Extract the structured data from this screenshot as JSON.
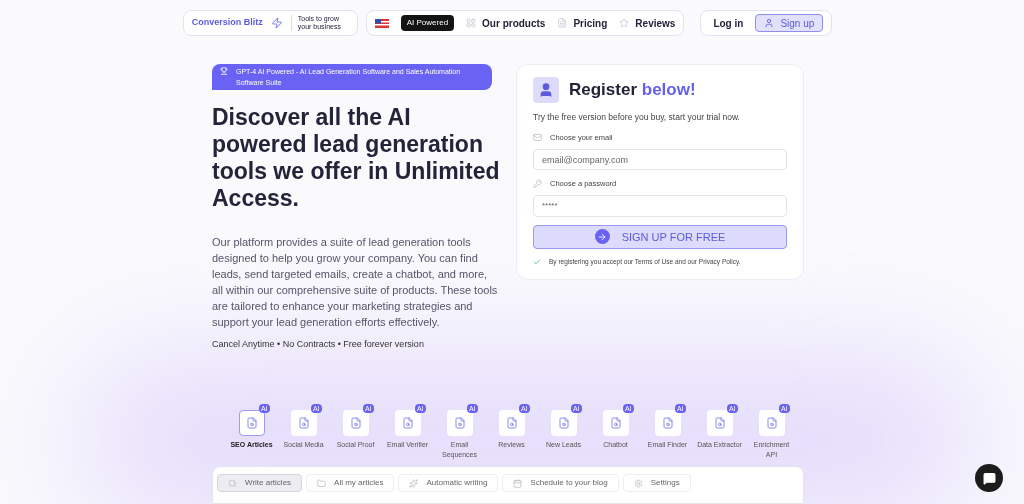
{
  "nav": {
    "brand": "Conversion Blitz",
    "tagline": "Tools to grow your business",
    "badge": "AI Powered",
    "links": [
      {
        "label": "Our products"
      },
      {
        "label": "Pricing"
      },
      {
        "label": "Reviews"
      }
    ],
    "login": "Log in",
    "signup": "Sign up"
  },
  "hero": {
    "pill": "GPT-4 AI Powered - AI Lead Generation Software and Sales Automation Software Suite",
    "title": "Discover all the AI powered lead generation tools we offer in Unlimited Access.",
    "body": "Our platform provides a suite of lead generation tools designed to help you grow your company. You can find leads, send targeted emails, create a chatbot, and more, all within our comprehensive suite of products. These tools are tailored to enhance your marketing strategies and support your lead generation efforts effectively.",
    "footnote": "Cancel Anytime • No Contracts • Free forever version"
  },
  "register": {
    "title": "Register",
    "title_accent": "below!",
    "subtitle": "Try the free version before you buy, start your trial now.",
    "email_label": "Choose your email",
    "email_placeholder": "email@company.com",
    "password_label": "Choose a password",
    "password_placeholder": "*****",
    "button": "SIGN UP FOR FREE",
    "terms": "By registering you accept our Terms of Use and our Privacy Policy."
  },
  "tools": [
    {
      "label": "SEO Articles",
      "badge": "AI",
      "selected": true
    },
    {
      "label": "Social Media",
      "badge": "AI",
      "selected": false
    },
    {
      "label": "Social Proof",
      "badge": "AI",
      "selected": false
    },
    {
      "label": "Email Verifier",
      "badge": "AI",
      "selected": false
    },
    {
      "label": "Email Sequences",
      "badge": "AI",
      "selected": false
    },
    {
      "label": "Reviews",
      "badge": "AI",
      "selected": false
    },
    {
      "label": "New Leads",
      "badge": "AI",
      "selected": false
    },
    {
      "label": "Chatbot",
      "badge": "AI",
      "selected": false
    },
    {
      "label": "Email Finder",
      "badge": "AI",
      "selected": false
    },
    {
      "label": "Data Extractor",
      "badge": "AI",
      "selected": false
    },
    {
      "label": "Enrichment API",
      "badge": "AI",
      "selected": false
    }
  ],
  "panel_tabs": [
    {
      "label": "Write articles",
      "selected": true
    },
    {
      "label": "All my articles",
      "selected": false
    },
    {
      "label": "Automatic writing",
      "selected": false
    },
    {
      "label": "Schedule to your blog",
      "selected": false
    },
    {
      "label": "Settings",
      "selected": false
    }
  ]
}
